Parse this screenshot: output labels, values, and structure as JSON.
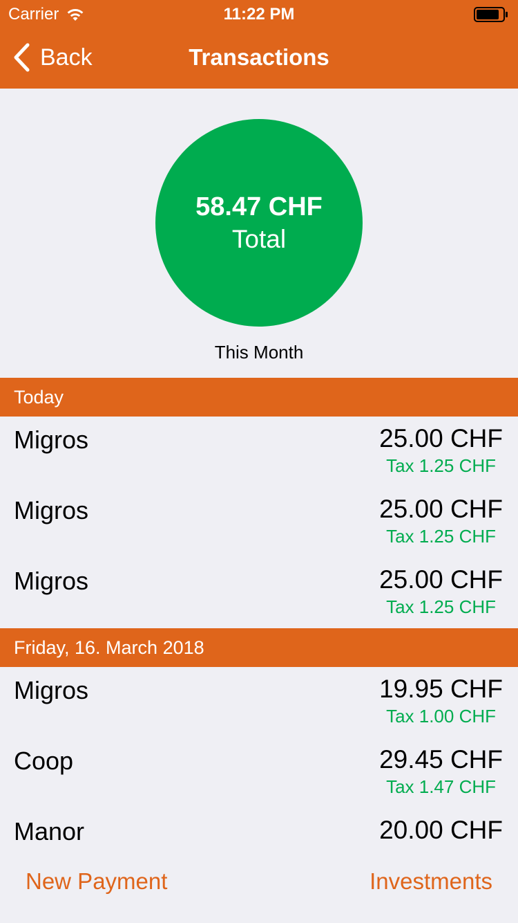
{
  "status_bar": {
    "carrier": "Carrier",
    "time": "11:22 PM"
  },
  "nav": {
    "back_label": "Back",
    "title": "Transactions"
  },
  "summary": {
    "total_amount": "58.47 CHF",
    "total_label": "Total",
    "period_label": "This Month"
  },
  "sections": [
    {
      "header": "Today",
      "rows": [
        {
          "merchant": "Migros",
          "amount": "25.00 CHF",
          "tax": "Tax 1.25 CHF"
        },
        {
          "merchant": "Migros",
          "amount": "25.00 CHF",
          "tax": "Tax 1.25 CHF"
        },
        {
          "merchant": "Migros",
          "amount": "25.00 CHF",
          "tax": "Tax 1.25 CHF"
        }
      ]
    },
    {
      "header": "Friday, 16. March 2018",
      "rows": [
        {
          "merchant": "Migros",
          "amount": "19.95 CHF",
          "tax": "Tax 1.00 CHF"
        },
        {
          "merchant": "Coop",
          "amount": "29.45 CHF",
          "tax": "Tax 1.47 CHF"
        },
        {
          "merchant": "Manor",
          "amount": "20.00 CHF"
        }
      ]
    }
  ],
  "toolbar": {
    "left_label": "New Payment",
    "right_label": "Investments"
  },
  "colors": {
    "accent": "#df651b",
    "positive": "#00ac4f",
    "background": "#efeff4"
  },
  "icons": {
    "back": "chevron-left-icon",
    "wifi": "wifi-icon",
    "battery": "battery-icon"
  }
}
